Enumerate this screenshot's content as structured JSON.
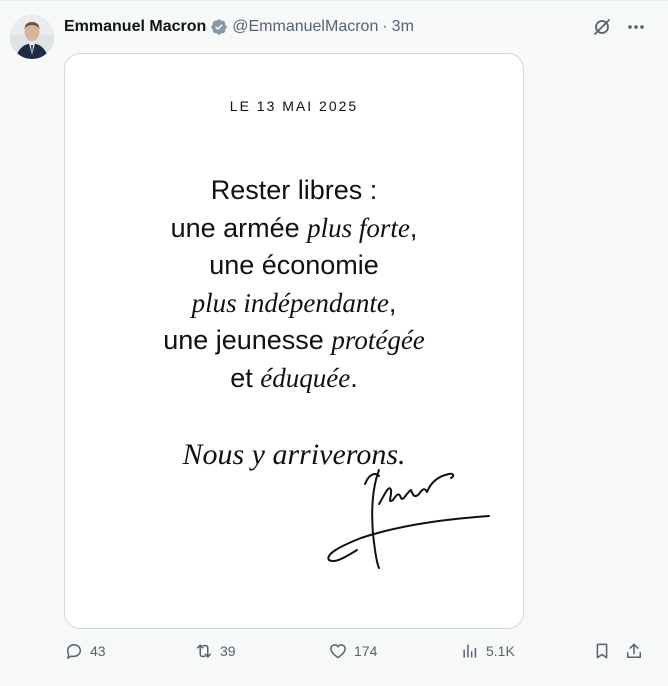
{
  "author": {
    "display_name": "Emmanuel Macron",
    "handle": "@EmmanuelMacron",
    "separator": "·",
    "time": "3m"
  },
  "post_image": {
    "date": "LE 13 MAI 2025",
    "lines": [
      [
        {
          "t": "Rester libres :",
          "i": false
        }
      ],
      [
        {
          "t": "une armée ",
          "i": false
        },
        {
          "t": "plus forte",
          "i": true
        },
        {
          "t": ",",
          "i": false
        }
      ],
      [
        {
          "t": "une économie",
          "i": false
        }
      ],
      [
        {
          "t": "plus indépendante",
          "i": true
        },
        {
          "t": ",",
          "i": false
        }
      ],
      [
        {
          "t": "une jeunesse ",
          "i": false
        },
        {
          "t": "protégée",
          "i": true
        }
      ],
      [
        {
          "t": "et ",
          "i": false
        },
        {
          "t": "éduquée",
          "i": true
        },
        {
          "t": ".",
          "i": false
        }
      ]
    ],
    "closing": "Nous y arriverons."
  },
  "actions": {
    "replies": "43",
    "reposts": "39",
    "likes": "174",
    "views": "5.1K"
  },
  "icons": {
    "verified": "verified-badge-icon",
    "grok": "grok-icon",
    "more": "more-icon",
    "reply": "reply-icon",
    "repost": "repost-icon",
    "like": "heart-icon",
    "views": "views-icon",
    "bookmark": "bookmark-icon",
    "share": "share-icon"
  },
  "colors": {
    "text_primary": "#0f1419",
    "text_secondary": "#536471",
    "badge": "#829aab"
  }
}
